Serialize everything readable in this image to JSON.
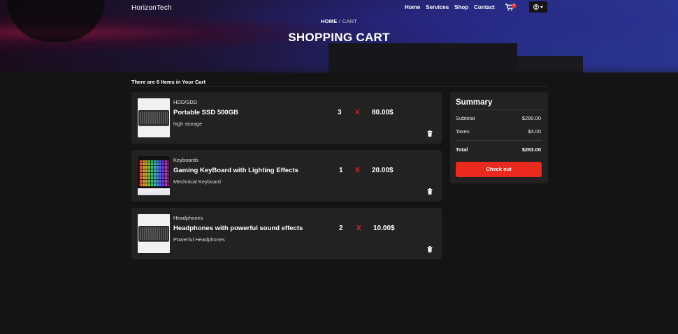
{
  "brand": "HorizonTech",
  "nav": {
    "links": [
      "Home",
      "Services",
      "Shop",
      "Contact"
    ],
    "cart_badge": "6",
    "cart_icon": "shopping-cart-icon",
    "user_icon": "user-circle-icon"
  },
  "hero": {
    "breadcrumb_home": "HOME",
    "breadcrumb_sep": " / ",
    "breadcrumb_current": "CART",
    "title": "SHOPPING CART"
  },
  "cart": {
    "count_text": "There are 6 Items in Your Cart",
    "items": [
      {
        "category": "HDD/SDD",
        "name": "Portable SSD 500GB",
        "description": "high storage",
        "quantity": "3",
        "times": "X",
        "price": "80.00$",
        "image_icon": "keyboard-image"
      },
      {
        "category": "Keyboards",
        "name": "Gaming KeyBoard with Lighting Effects",
        "description": "Mechnical Keyboard",
        "quantity": "1",
        "times": "X",
        "price": "20.00$",
        "image_icon": "rgb-keyboard-image"
      },
      {
        "category": "Headphones",
        "name": "Headphones with powerful sound effects",
        "description": "Powerful Headphones",
        "quantity": "2",
        "times": "X",
        "price": "10.00$",
        "image_icon": "keyboard-image"
      }
    ]
  },
  "summary": {
    "title": "Summary",
    "subtotal_label": "Subtotal",
    "subtotal_value": "$280.00",
    "taxes_label": "Taxes",
    "taxes_value": "$3.00",
    "total_label": "Total",
    "total_value": "$283.00",
    "checkout_label": "Check out"
  },
  "colors": {
    "accent": "#ea2a1e",
    "background": "#141414",
    "card": "#222222"
  }
}
